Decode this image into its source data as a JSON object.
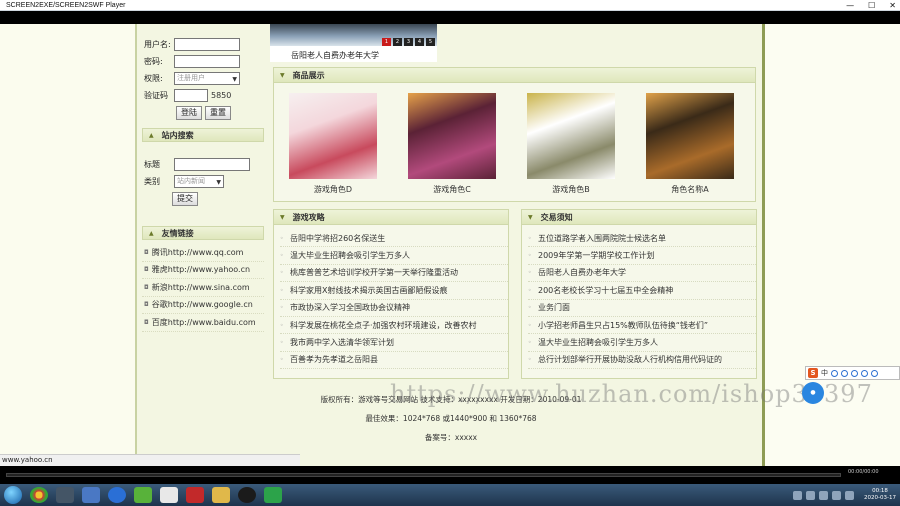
{
  "window": {
    "title": "SCREEN2EXE/SCREEN2SWF Player"
  },
  "sidebar": {
    "login": {
      "username_label": "用户名:",
      "password_label": "密码:",
      "role_label": "权限:",
      "role_value": "注册用户",
      "code_label": "验证码",
      "code_value": "5850",
      "login_button": "登陆",
      "reset_button": "重置"
    },
    "search": {
      "title": "站内搜索",
      "keyword_label": "标题",
      "category_label": "类别",
      "category_value": "站内新闻",
      "submit_button": "提交"
    },
    "links": {
      "title": "友情链接",
      "items": [
        "腾讯http://www.qq.com",
        "雅虎http://www.yahoo.cn",
        "新浪http://www.sina.com",
        "谷歌http://www.google.cn",
        "百度http://www.baidu.com"
      ]
    }
  },
  "banner": {
    "caption": "岳阳老人自费办老年大学",
    "pages": [
      "1",
      "2",
      "3",
      "4",
      "5"
    ]
  },
  "products": {
    "title": "商品展示",
    "items": [
      {
        "name": "游戏角色D",
        "colors": [
          "#f4d7dc",
          "#c84a5d",
          "#f6f0f0"
        ]
      },
      {
        "name": "游戏角色C",
        "colors": [
          "#5b2236",
          "#b24a7c",
          "#e6a24a"
        ]
      },
      {
        "name": "游戏角色B",
        "colors": [
          "#ffffff",
          "#8a8a6a",
          "#c9b34a"
        ]
      },
      {
        "name": "角色名称A",
        "colors": [
          "#3a2a18",
          "#a96b2a",
          "#e0a24a"
        ]
      }
    ]
  },
  "news": {
    "guides": {
      "title": "游戏攻略",
      "items": [
        "岳阳中学将招260名保送生",
        "温大毕业生招聘会吸引学生万多人",
        "桃库普普艺术培训学校开学第一天举行隆重活动",
        "科学家用X射线技术揭示英国古画鄙陋假设痕",
        "市政协深入学习全国政协会议精神",
        "科学发展在桃花全点子·加强农村环境建设，改善农村",
        "我市两中学入选清华领军计划",
        "百善孝为先孝道之岳阳县"
      ]
    },
    "notices": {
      "title": "交易须知",
      "items": [
        "五位道路学者入围两院院士候选名单",
        "2009年学第一学期学校工作计划",
        "岳阳老人自费办老年大学",
        "200名老校长学习十七届五中全会精神",
        "业务门面",
        "小学招老师昌生只占15%教师队伍待换“钱老们”",
        "温大毕业生招聘会吸引学生万多人",
        "总行计划部举行开展协助没敌人行机构信用代码证的"
      ]
    }
  },
  "footer": {
    "copyright": "版权所有：游戏等号交易网站 技术支持：xxxxxxxxx 开发日期：2010-09-01",
    "resolution": "最佳效果：1024*768 或1440*900 和 1360*768",
    "icp": "备案号：xxxxx"
  },
  "watermark": "https://www.huzhan.com/ishop39397",
  "statusbar": "www.yahoo.cn",
  "ime": {
    "label": "中"
  },
  "player": {
    "position": "00:00/00:00"
  },
  "clock": {
    "time": "00:18",
    "date": "2020-03-17"
  }
}
